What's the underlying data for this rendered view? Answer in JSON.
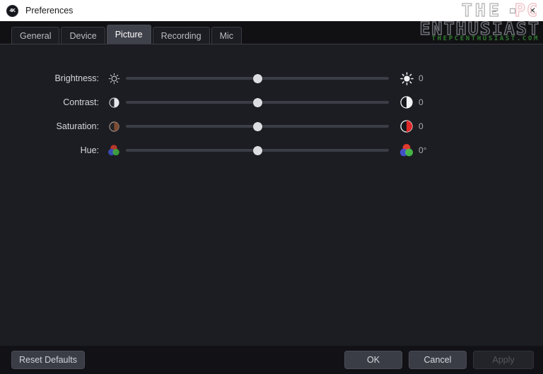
{
  "window": {
    "title": "Preferences",
    "app_icon": "4K",
    "minimize_label": "–",
    "maximize_label": "□",
    "close_label": "✕"
  },
  "tabs": [
    {
      "label": "General",
      "active": false
    },
    {
      "label": "Device",
      "active": false
    },
    {
      "label": "Picture",
      "active": true
    },
    {
      "label": "Recording",
      "active": false
    },
    {
      "label": "Mic",
      "active": false
    }
  ],
  "settings": [
    {
      "label": "Brightness:",
      "value": "0",
      "icon_left": "brightness-outline-icon",
      "icon_right": "brightness-filled-icon",
      "position_pct": 50
    },
    {
      "label": "Contrast:",
      "value": "0",
      "icon_left": "contrast-half-circle-icon",
      "icon_right": "contrast-half-circle-icon",
      "position_pct": 50
    },
    {
      "label": "Saturation:",
      "value": "0",
      "icon_left": "saturation-half-circle-icon",
      "icon_right": "saturation-half-circle-icon",
      "position_pct": 50
    },
    {
      "label": "Hue:",
      "value": "0°",
      "icon_left": "hue-color-wheel-icon",
      "icon_right": "hue-color-wheel-icon",
      "position_pct": 50
    }
  ],
  "footer": {
    "reset_label": "Reset Defaults",
    "ok_label": "OK",
    "cancel_label": "Cancel",
    "apply_label": "Apply"
  },
  "watermark": {
    "line1_a": "THE",
    "line1_b": "PC",
    "line2": "ENTHUSIAST",
    "url": "THEPCENTHUSIAST.COM"
  },
  "colors": {
    "window_bg": "#1c1d22",
    "titlebar_bg": "#ffffff",
    "tabbar_bg": "#111114",
    "active_tab_bg": "#40424b",
    "footer_bg": "#121216",
    "slider_track": "#3c3e47",
    "slider_thumb": "#dcdde1",
    "watermark_green": "#2f7a2f"
  }
}
